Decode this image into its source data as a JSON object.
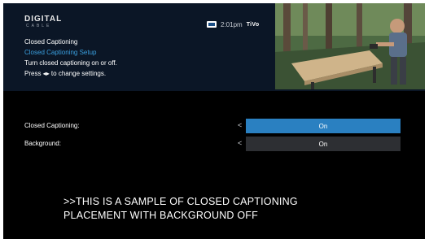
{
  "brand": {
    "logo_main": "DIGITAL",
    "logo_sub": "CABLE"
  },
  "status": {
    "channel_icon": "tv-icon",
    "time": "2:01pm",
    "provider_logo": "TiVo"
  },
  "menu": {
    "lines": [
      "Closed Captioning",
      "Closed Captioning Setup",
      "Turn closed captioning on or off.",
      "Press ◂▸ to change settings."
    ]
  },
  "settings": {
    "closed_captioning": {
      "label": "Closed Captioning:",
      "value": "On"
    },
    "background": {
      "label": "Background:",
      "value": "On"
    },
    "arrow_glyph": "<"
  },
  "caption_sample": {
    "line1": ">>THIS IS A SAMPLE OF CLOSED CAPTIONING",
    "line2": "PLACEMENT WITH BACKGROUND OFF"
  },
  "colors": {
    "header_bg": "#0b1626",
    "highlight_text": "#3aa0e0",
    "selected_row": "#2a80c1",
    "unselected_row": "#2d2f33"
  }
}
